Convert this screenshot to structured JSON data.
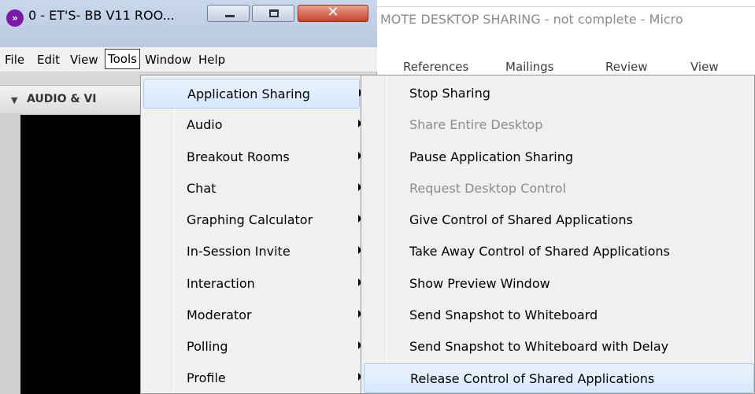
{
  "word_window": {
    "title": "MOTE DESKTOP SHARING - not complete  -  Micro",
    "ribbon_tabs": [
      "References",
      "Mailings",
      "Review",
      "View"
    ]
  },
  "app_window": {
    "title": "0 - ET'S- BB V11 ROO...",
    "icon_glyph": "»",
    "close_glyph": "✕",
    "menubar": [
      "File",
      "Edit",
      "View",
      "Tools",
      "Window",
      "Help"
    ],
    "active_menu": "Tools",
    "panel_title": "AUDIO & VI",
    "panel_arrow": "▼"
  },
  "tools_menu": {
    "items": [
      {
        "label": "Application Sharing",
        "has_submenu": true,
        "highlighted": true
      },
      {
        "label": "Audio",
        "has_submenu": true
      },
      {
        "label": "Breakout Rooms",
        "has_submenu": true
      },
      {
        "label": "Chat",
        "has_submenu": true
      },
      {
        "label": "Graphing Calculator",
        "has_submenu": true
      },
      {
        "label": "In-Session Invite",
        "has_submenu": true
      },
      {
        "label": "Interaction",
        "has_submenu": true
      },
      {
        "label": "Moderator",
        "has_submenu": true
      },
      {
        "label": "Polling",
        "has_submenu": true
      },
      {
        "label": "Profile",
        "has_submenu": true
      }
    ]
  },
  "sharing_submenu": {
    "items": [
      {
        "label": "Stop Sharing",
        "enabled": true
      },
      {
        "label": "Share Entire Desktop",
        "enabled": false
      },
      {
        "label": "Pause Application Sharing",
        "enabled": true
      },
      {
        "label": "Request Desktop Control",
        "enabled": false
      },
      {
        "label": "Give Control of Shared Applications",
        "enabled": true
      },
      {
        "label": "Take Away Control of Shared Applications",
        "enabled": true
      },
      {
        "label": "Show Preview Window",
        "enabled": true
      },
      {
        "label": "Send Snapshot to Whiteboard",
        "enabled": true
      },
      {
        "label": "Send Snapshot to Whiteboard with Delay",
        "enabled": true
      },
      {
        "label": "Release Control of Shared Applications",
        "enabled": true,
        "highlighted": true
      }
    ]
  },
  "colors": {
    "highlight": "#d7e8fb",
    "disabled_text": "#8d8d8d",
    "app_icon": "#7a1aa8",
    "close_button": "#c8422c"
  }
}
